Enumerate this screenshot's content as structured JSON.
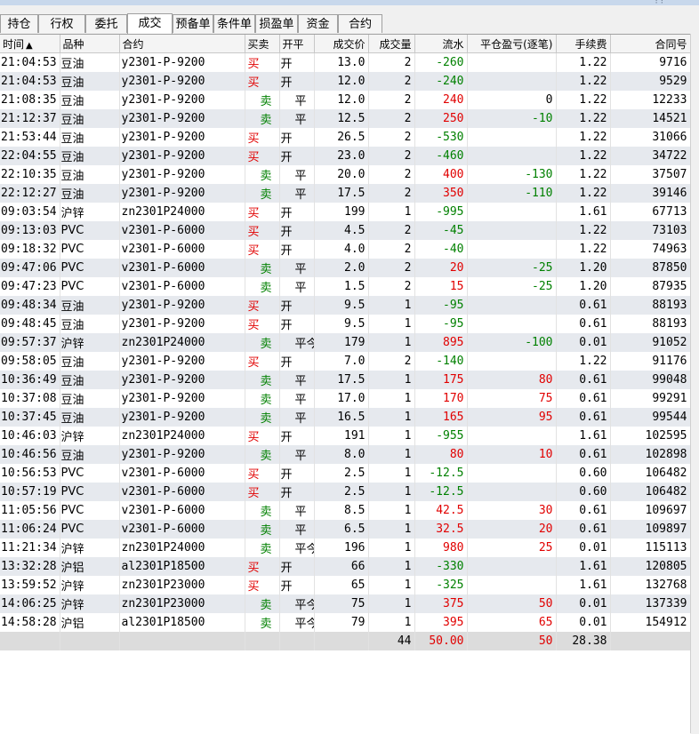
{
  "tabs": [
    "持仓",
    "行权",
    "委托",
    "成交",
    "预备单",
    "条件单",
    "损盈单",
    "资金",
    "合约"
  ],
  "active_tab": "成交",
  "columns": {
    "time": "时间",
    "sort_indicator": "▲",
    "product": "品种",
    "contract": "合约",
    "bs": "买卖",
    "oc": "开平",
    "price": "成交价",
    "qty": "成交量",
    "flow": "流水",
    "pnl": "平仓盈亏(逐笔)",
    "fee": "手续费",
    "id": "合同号"
  },
  "rows": [
    {
      "time": "21:04:53",
      "product": "豆油",
      "contract": "y2301-P-9200",
      "bs": "买",
      "oc": "开",
      "price": "13.0",
      "qty": "2",
      "flow": "-260",
      "pnl": "",
      "fee": "1.22",
      "id": "9716"
    },
    {
      "time": "21:04:53",
      "product": "豆油",
      "contract": "y2301-P-9200",
      "bs": "买",
      "oc": "开",
      "price": "12.0",
      "qty": "2",
      "flow": "-240",
      "pnl": "",
      "fee": "1.22",
      "id": "9529"
    },
    {
      "time": "21:08:35",
      "product": "豆油",
      "contract": "y2301-P-9200",
      "bs": "卖",
      "oc": "平",
      "price": "12.0",
      "qty": "2",
      "flow": "240",
      "pnl": "0",
      "fee": "1.22",
      "id": "12233"
    },
    {
      "time": "21:12:37",
      "product": "豆油",
      "contract": "y2301-P-9200",
      "bs": "卖",
      "oc": "平",
      "price": "12.5",
      "qty": "2",
      "flow": "250",
      "pnl": "-10",
      "fee": "1.22",
      "id": "14521"
    },
    {
      "time": "21:53:44",
      "product": "豆油",
      "contract": "y2301-P-9200",
      "bs": "买",
      "oc": "开",
      "price": "26.5",
      "qty": "2",
      "flow": "-530",
      "pnl": "",
      "fee": "1.22",
      "id": "31066"
    },
    {
      "time": "22:04:55",
      "product": "豆油",
      "contract": "y2301-P-9200",
      "bs": "买",
      "oc": "开",
      "price": "23.0",
      "qty": "2",
      "flow": "-460",
      "pnl": "",
      "fee": "1.22",
      "id": "34722"
    },
    {
      "time": "22:10:35",
      "product": "豆油",
      "contract": "y2301-P-9200",
      "bs": "卖",
      "oc": "平",
      "price": "20.0",
      "qty": "2",
      "flow": "400",
      "pnl": "-130",
      "fee": "1.22",
      "id": "37507"
    },
    {
      "time": "22:12:27",
      "product": "豆油",
      "contract": "y2301-P-9200",
      "bs": "卖",
      "oc": "平",
      "price": "17.5",
      "qty": "2",
      "flow": "350",
      "pnl": "-110",
      "fee": "1.22",
      "id": "39146"
    },
    {
      "time": "09:03:54",
      "product": "沪锌",
      "contract": "zn2301P24000",
      "bs": "买",
      "oc": "开",
      "price": "199",
      "qty": "1",
      "flow": "-995",
      "pnl": "",
      "fee": "1.61",
      "id": "67713"
    },
    {
      "time": "09:13:03",
      "product": "PVC",
      "contract": "v2301-P-6000",
      "bs": "买",
      "oc": "开",
      "price": "4.5",
      "qty": "2",
      "flow": "-45",
      "pnl": "",
      "fee": "1.22",
      "id": "73103"
    },
    {
      "time": "09:18:32",
      "product": "PVC",
      "contract": "v2301-P-6000",
      "bs": "买",
      "oc": "开",
      "price": "4.0",
      "qty": "2",
      "flow": "-40",
      "pnl": "",
      "fee": "1.22",
      "id": "74963"
    },
    {
      "time": "09:47:06",
      "product": "PVC",
      "contract": "v2301-P-6000",
      "bs": "卖",
      "oc": "平",
      "price": "2.0",
      "qty": "2",
      "flow": "20",
      "pnl": "-25",
      "fee": "1.20",
      "id": "87850"
    },
    {
      "time": "09:47:23",
      "product": "PVC",
      "contract": "v2301-P-6000",
      "bs": "卖",
      "oc": "平",
      "price": "1.5",
      "qty": "2",
      "flow": "15",
      "pnl": "-25",
      "fee": "1.20",
      "id": "87935"
    },
    {
      "time": "09:48:34",
      "product": "豆油",
      "contract": "y2301-P-9200",
      "bs": "买",
      "oc": "开",
      "price": "9.5",
      "qty": "1",
      "flow": "-95",
      "pnl": "",
      "fee": "0.61",
      "id": "88193"
    },
    {
      "time": "09:48:45",
      "product": "豆油",
      "contract": "y2301-P-9200",
      "bs": "买",
      "oc": "开",
      "price": "9.5",
      "qty": "1",
      "flow": "-95",
      "pnl": "",
      "fee": "0.61",
      "id": "88193"
    },
    {
      "time": "09:57:37",
      "product": "沪锌",
      "contract": "zn2301P24000",
      "bs": "卖",
      "oc": "平今",
      "price": "179",
      "qty": "1",
      "flow": "895",
      "pnl": "-100",
      "fee": "0.01",
      "id": "91052"
    },
    {
      "time": "09:58:05",
      "product": "豆油",
      "contract": "y2301-P-9200",
      "bs": "买",
      "oc": "开",
      "price": "7.0",
      "qty": "2",
      "flow": "-140",
      "pnl": "",
      "fee": "1.22",
      "id": "91176"
    },
    {
      "time": "10:36:49",
      "product": "豆油",
      "contract": "y2301-P-9200",
      "bs": "卖",
      "oc": "平",
      "price": "17.5",
      "qty": "1",
      "flow": "175",
      "pnl": "80",
      "fee": "0.61",
      "id": "99048"
    },
    {
      "time": "10:37:08",
      "product": "豆油",
      "contract": "y2301-P-9200",
      "bs": "卖",
      "oc": "平",
      "price": "17.0",
      "qty": "1",
      "flow": "170",
      "pnl": "75",
      "fee": "0.61",
      "id": "99291"
    },
    {
      "time": "10:37:45",
      "product": "豆油",
      "contract": "y2301-P-9200",
      "bs": "卖",
      "oc": "平",
      "price": "16.5",
      "qty": "1",
      "flow": "165",
      "pnl": "95",
      "fee": "0.61",
      "id": "99544"
    },
    {
      "time": "10:46:03",
      "product": "沪锌",
      "contract": "zn2301P24000",
      "bs": "买",
      "oc": "开",
      "price": "191",
      "qty": "1",
      "flow": "-955",
      "pnl": "",
      "fee": "1.61",
      "id": "102595"
    },
    {
      "time": "10:46:56",
      "product": "豆油",
      "contract": "y2301-P-9200",
      "bs": "卖",
      "oc": "平",
      "price": "8.0",
      "qty": "1",
      "flow": "80",
      "pnl": "10",
      "fee": "0.61",
      "id": "102898"
    },
    {
      "time": "10:56:53",
      "product": "PVC",
      "contract": "v2301-P-6000",
      "bs": "买",
      "oc": "开",
      "price": "2.5",
      "qty": "1",
      "flow": "-12.5",
      "pnl": "",
      "fee": "0.60",
      "id": "106482"
    },
    {
      "time": "10:57:19",
      "product": "PVC",
      "contract": "v2301-P-6000",
      "bs": "买",
      "oc": "开",
      "price": "2.5",
      "qty": "1",
      "flow": "-12.5",
      "pnl": "",
      "fee": "0.60",
      "id": "106482"
    },
    {
      "time": "11:05:56",
      "product": "PVC",
      "contract": "v2301-P-6000",
      "bs": "卖",
      "oc": "平",
      "price": "8.5",
      "qty": "1",
      "flow": "42.5",
      "pnl": "30",
      "fee": "0.61",
      "id": "109697"
    },
    {
      "time": "11:06:24",
      "product": "PVC",
      "contract": "v2301-P-6000",
      "bs": "卖",
      "oc": "平",
      "price": "6.5",
      "qty": "1",
      "flow": "32.5",
      "pnl": "20",
      "fee": "0.61",
      "id": "109897"
    },
    {
      "time": "11:21:34",
      "product": "沪锌",
      "contract": "zn2301P24000",
      "bs": "卖",
      "oc": "平今",
      "price": "196",
      "qty": "1",
      "flow": "980",
      "pnl": "25",
      "fee": "0.01",
      "id": "115113"
    },
    {
      "time": "13:32:28",
      "product": "沪铝",
      "contract": "al2301P18500",
      "bs": "买",
      "oc": "开",
      "price": "66",
      "qty": "1",
      "flow": "-330",
      "pnl": "",
      "fee": "1.61",
      "id": "120805"
    },
    {
      "time": "13:59:52",
      "product": "沪锌",
      "contract": "zn2301P23000",
      "bs": "买",
      "oc": "开",
      "price": "65",
      "qty": "1",
      "flow": "-325",
      "pnl": "",
      "fee": "1.61",
      "id": "132768"
    },
    {
      "time": "14:06:25",
      "product": "沪锌",
      "contract": "zn2301P23000",
      "bs": "卖",
      "oc": "平今",
      "price": "75",
      "qty": "1",
      "flow": "375",
      "pnl": "50",
      "fee": "0.01",
      "id": "137339"
    },
    {
      "time": "14:58:28",
      "product": "沪铝",
      "contract": "al2301P18500",
      "bs": "卖",
      "oc": "平今",
      "price": "79",
      "qty": "1",
      "flow": "395",
      "pnl": "65",
      "fee": "0.01",
      "id": "154912"
    }
  ],
  "totals": {
    "qty": "44",
    "flow": "50.00",
    "pnl": "50",
    "fee": "28.38"
  },
  "colors": {
    "buy": "#e10000",
    "sell": "#008000",
    "positive": "#e10000",
    "negative": "#008000"
  }
}
